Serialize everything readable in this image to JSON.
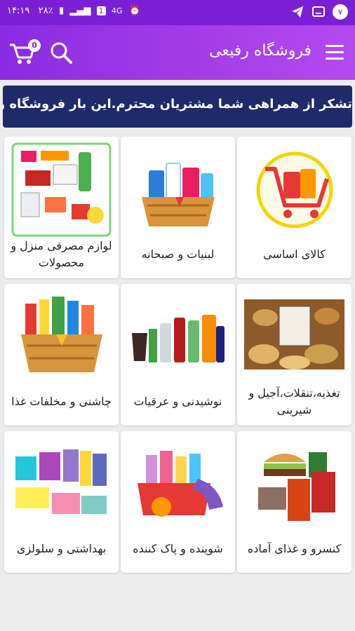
{
  "status_bar": {
    "time": "۱۴:۱۹",
    "battery": "۲۸٪",
    "network": "4G",
    "sim": "1",
    "notification_count": "۷",
    "icons": [
      "telegram-icon",
      "cast-icon",
      "alarm-icon",
      "signal-icon",
      "battery-icon"
    ]
  },
  "app_bar": {
    "title": "فروشگاه رفیعی",
    "cart_count": "0",
    "accent": "#8a2be2"
  },
  "marquee": {
    "text": "تشکر از همراهی شما مشتریان محترم.این بار فروشگاه رفیعی"
  },
  "categories": [
    {
      "label": "کالای اساسی",
      "image": "basic-goods-logo"
    },
    {
      "label": "لبنیات و صبحانه",
      "image": "dairy-basket"
    },
    {
      "label": "لوازم مصرفی منزل و محصولات",
      "image": "household-supplies"
    },
    {
      "label": "تغذیه،تنقلات،آجیل و شیرینی",
      "image": "nuts-snacks"
    },
    {
      "label": "نوشیدنی و عرقیات",
      "image": "drinks-bottles"
    },
    {
      "label": "چاشنی و مخلفات غذا",
      "image": "condiments-basket"
    },
    {
      "label": "کنسرو و غذای آماده",
      "image": "canned-food"
    },
    {
      "label": "شوینده و پاک کننده",
      "image": "cleaning-products"
    },
    {
      "label": "بهداشتی و سلولزی",
      "image": "hygiene-products"
    }
  ]
}
